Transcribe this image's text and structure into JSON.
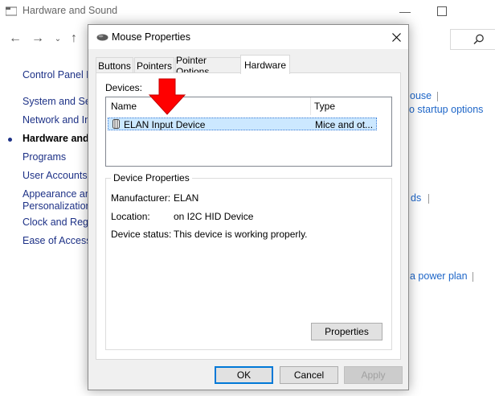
{
  "background_window": {
    "title": "Hardware and Sound",
    "side_links": [
      "Control Panel H",
      "System and Sec",
      "Network and In",
      "Hardware and S",
      "Programs",
      "User Accounts",
      "Appearance and",
      "Personalization",
      "Clock and Regio",
      "Ease of Access"
    ],
    "right_links": [
      "ouse",
      "o startup options",
      "ds",
      "a power plan"
    ]
  },
  "dialog": {
    "title": "Mouse Properties",
    "tabs": [
      "Buttons",
      "Pointers",
      "Pointer Options",
      "Hardware"
    ],
    "active_tab": "Hardware",
    "devices_label": "Devices:",
    "columns": [
      "Name",
      "Type"
    ],
    "devices": [
      {
        "name": "ELAN Input Device",
        "type": "Mice and ot..."
      }
    ],
    "device_properties": {
      "title": "Device Properties",
      "manufacturer_label": "Manufacturer:",
      "manufacturer_value": "ELAN",
      "location_label": "Location:",
      "location_value": "on I2C HID Device",
      "status_label": "Device status:",
      "status_value": "This device is working properly."
    },
    "buttons": {
      "properties": "Properties",
      "ok": "OK",
      "cancel": "Cancel",
      "apply": "Apply"
    }
  },
  "colors": {
    "accent": "#0078d7",
    "link": "#1e3287",
    "selection": "#cce8ff",
    "annotation_arrow": "#ff0000"
  },
  "icons": [
    "folder-icon",
    "minimize-icon",
    "maximize-icon",
    "back-icon",
    "forward-icon",
    "history-dropdown-icon",
    "up-icon",
    "search-icon",
    "mouse-icon",
    "close-icon",
    "device-icon",
    "red-arrow-annotation"
  ]
}
